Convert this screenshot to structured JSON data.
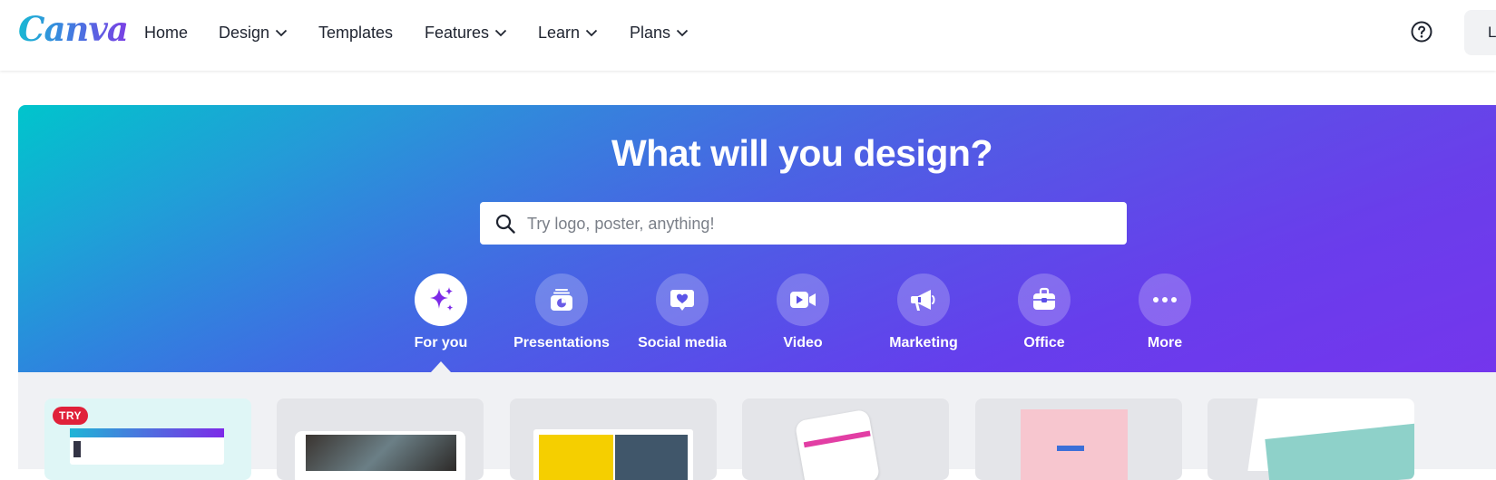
{
  "header": {
    "logo_text": "Canva",
    "nav": [
      {
        "label": "Home",
        "has_dropdown": false
      },
      {
        "label": "Design",
        "has_dropdown": true
      },
      {
        "label": "Templates",
        "has_dropdown": false
      },
      {
        "label": "Features",
        "has_dropdown": true
      },
      {
        "label": "Learn",
        "has_dropdown": true
      },
      {
        "label": "Plans",
        "has_dropdown": true
      }
    ],
    "help_icon": "question-circle-icon",
    "login_label": "L"
  },
  "hero": {
    "title": "What will you design?",
    "search_placeholder": "Try logo, poster, anything!",
    "search_value": "",
    "categories": [
      {
        "label": "For you",
        "icon": "sparkle-icon",
        "active": true
      },
      {
        "label": "Presentations",
        "icon": "presentation-icon",
        "active": false
      },
      {
        "label": "Social media",
        "icon": "heart-chat-icon",
        "active": false
      },
      {
        "label": "Video",
        "icon": "video-camera-icon",
        "active": false
      },
      {
        "label": "Marketing",
        "icon": "megaphone-icon",
        "active": false
      },
      {
        "label": "Office",
        "icon": "briefcase-icon",
        "active": false
      },
      {
        "label": "More",
        "icon": "more-dots-icon",
        "active": false
      }
    ]
  },
  "cards": {
    "badge": "TRY"
  },
  "colors": {
    "accent": "#7d2ae8",
    "hero_start": "#00c5cc",
    "hero_end": "#6f2ff5",
    "badge": "#e0213a"
  }
}
